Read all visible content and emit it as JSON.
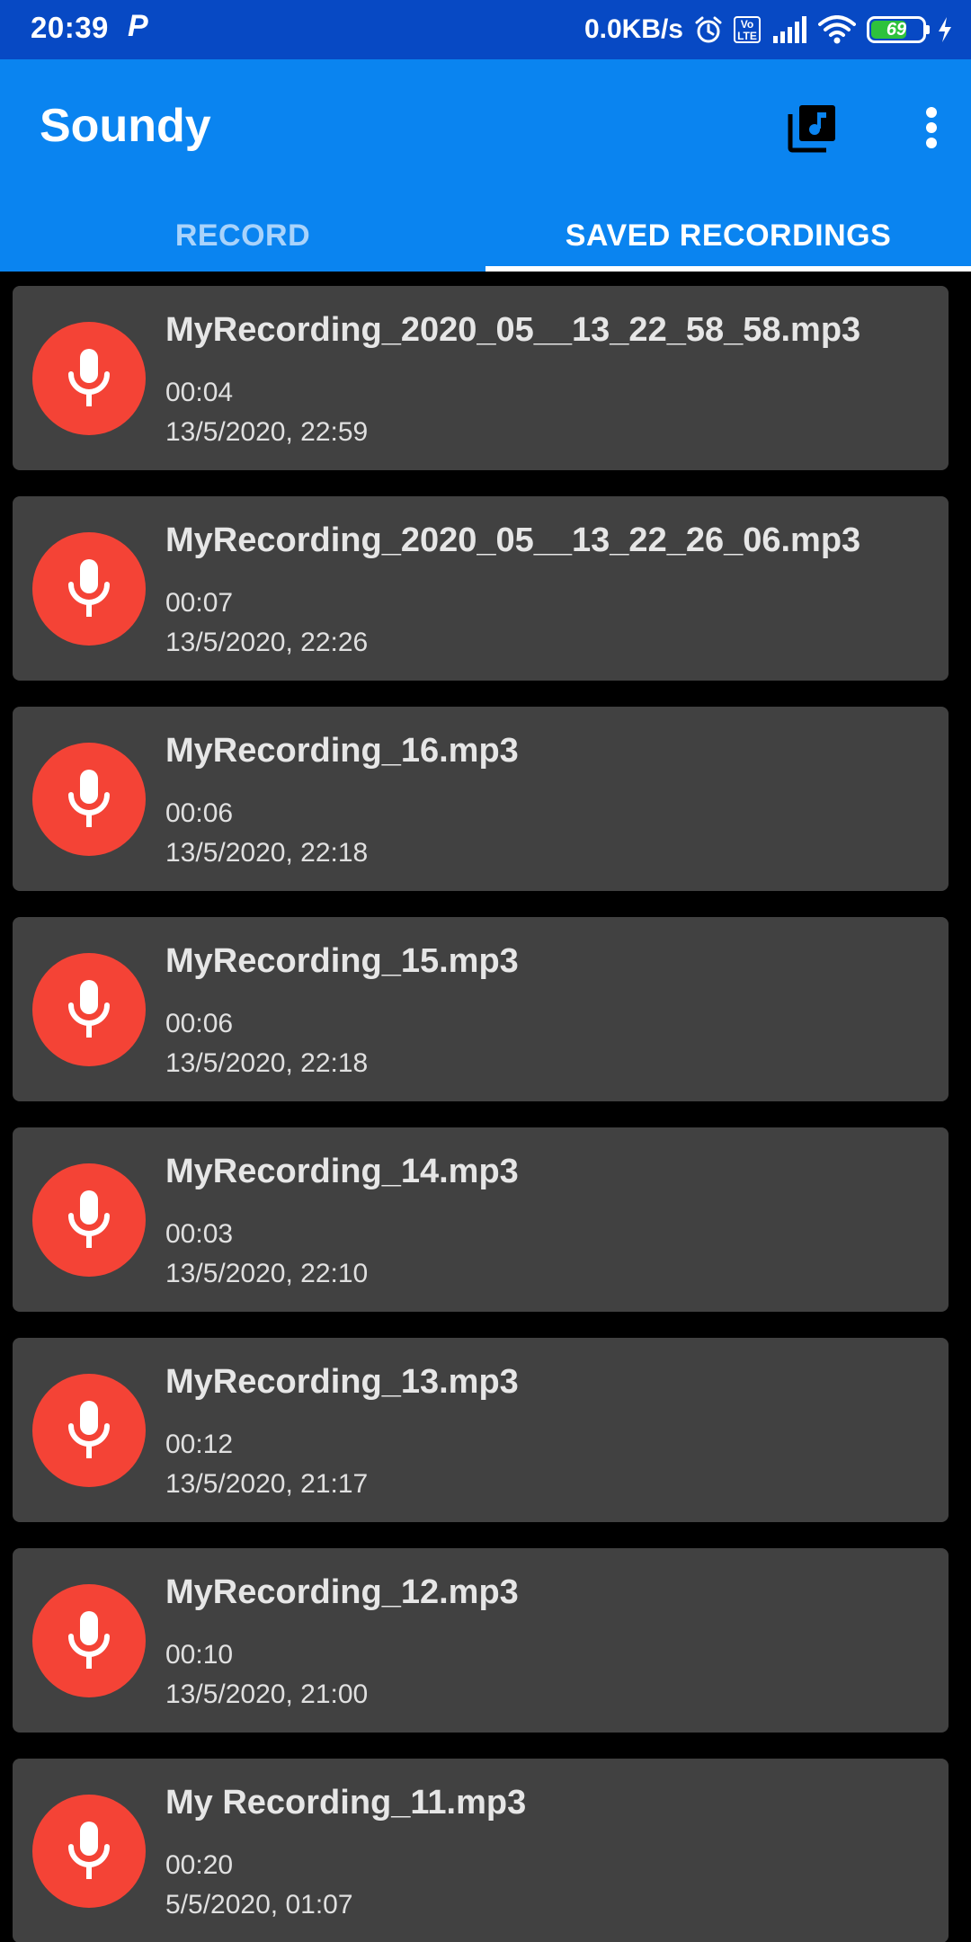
{
  "status_bar": {
    "time": "20:39",
    "notification": "P",
    "net_speed": "0.0KB/s",
    "volte": "Vo\nLTE",
    "battery": "69",
    "battery_level": 0.69
  },
  "app_bar": {
    "title": "Soundy",
    "library_icon": "music-library-icon",
    "more_icon": "more-vert-icon"
  },
  "tabs": [
    {
      "label": "RECORD",
      "active": false
    },
    {
      "label": "SAVED RECORDINGS",
      "active": true
    }
  ],
  "colors": {
    "status_bar": "#0749c4",
    "app_bar": "#0a84f0",
    "card": "#414141",
    "mic": "#f44336"
  },
  "recordings": [
    {
      "name": "MyRecording_2020_05__13_22_58_58.mp3",
      "duration": "00:04",
      "date": "13/5/2020, 22:59"
    },
    {
      "name": "MyRecording_2020_05__13_22_26_06.mp3",
      "duration": "00:07",
      "date": "13/5/2020, 22:26"
    },
    {
      "name": "MyRecording_16.mp3",
      "duration": "00:06",
      "date": "13/5/2020, 22:18"
    },
    {
      "name": "MyRecording_15.mp3",
      "duration": "00:06",
      "date": "13/5/2020, 22:18"
    },
    {
      "name": "MyRecording_14.mp3",
      "duration": "00:03",
      "date": "13/5/2020, 22:10"
    },
    {
      "name": "MyRecording_13.mp3",
      "duration": "00:12",
      "date": "13/5/2020, 21:17"
    },
    {
      "name": "MyRecording_12.mp3",
      "duration": "00:10",
      "date": "13/5/2020, 21:00"
    },
    {
      "name": "My Recording_11.mp3",
      "duration": "00:20",
      "date": "5/5/2020, 01:07"
    }
  ]
}
